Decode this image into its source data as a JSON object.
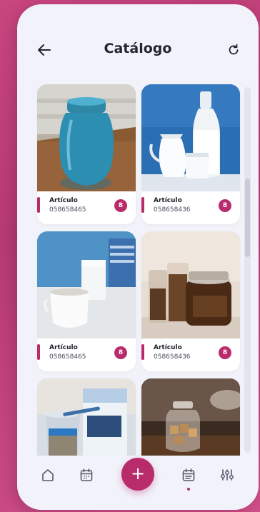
{
  "header": {
    "title": "Catálogo",
    "back_icon": "arrow-left-icon",
    "refresh_icon": "refresh-icon"
  },
  "products": [
    {
      "name": "Artículo",
      "code": "058658465",
      "count": "8",
      "image": "blue-glass-jar-on-wooden-tray"
    },
    {
      "name": "Artículo",
      "code": "058658436",
      "count": "8",
      "image": "milk-jugs-and-bottle-on-blue-background"
    },
    {
      "name": "Artículo",
      "code": "058658465",
      "count": "8",
      "image": "white-creamer-and-milk-glass"
    },
    {
      "name": "Artículo",
      "code": "058658436",
      "count": "8",
      "image": "glass-jars-with-pickled-food"
    },
    {
      "name": "",
      "code": "",
      "count": "",
      "image": "chia-pudding-with-oatly-carton"
    },
    {
      "name": "",
      "code": "",
      "count": "",
      "image": "glass-jar-with-sugar-cubes"
    }
  ],
  "bottom_nav": {
    "items": [
      "home-icon",
      "calendar-icon",
      "add-icon",
      "checklist-calendar-icon",
      "sliders-icon"
    ],
    "fab_label": "+"
  },
  "colors": {
    "accent": "#b82c6c",
    "background": "#f2f3fa",
    "card": "#ffffff",
    "outer": "#c9467f"
  }
}
